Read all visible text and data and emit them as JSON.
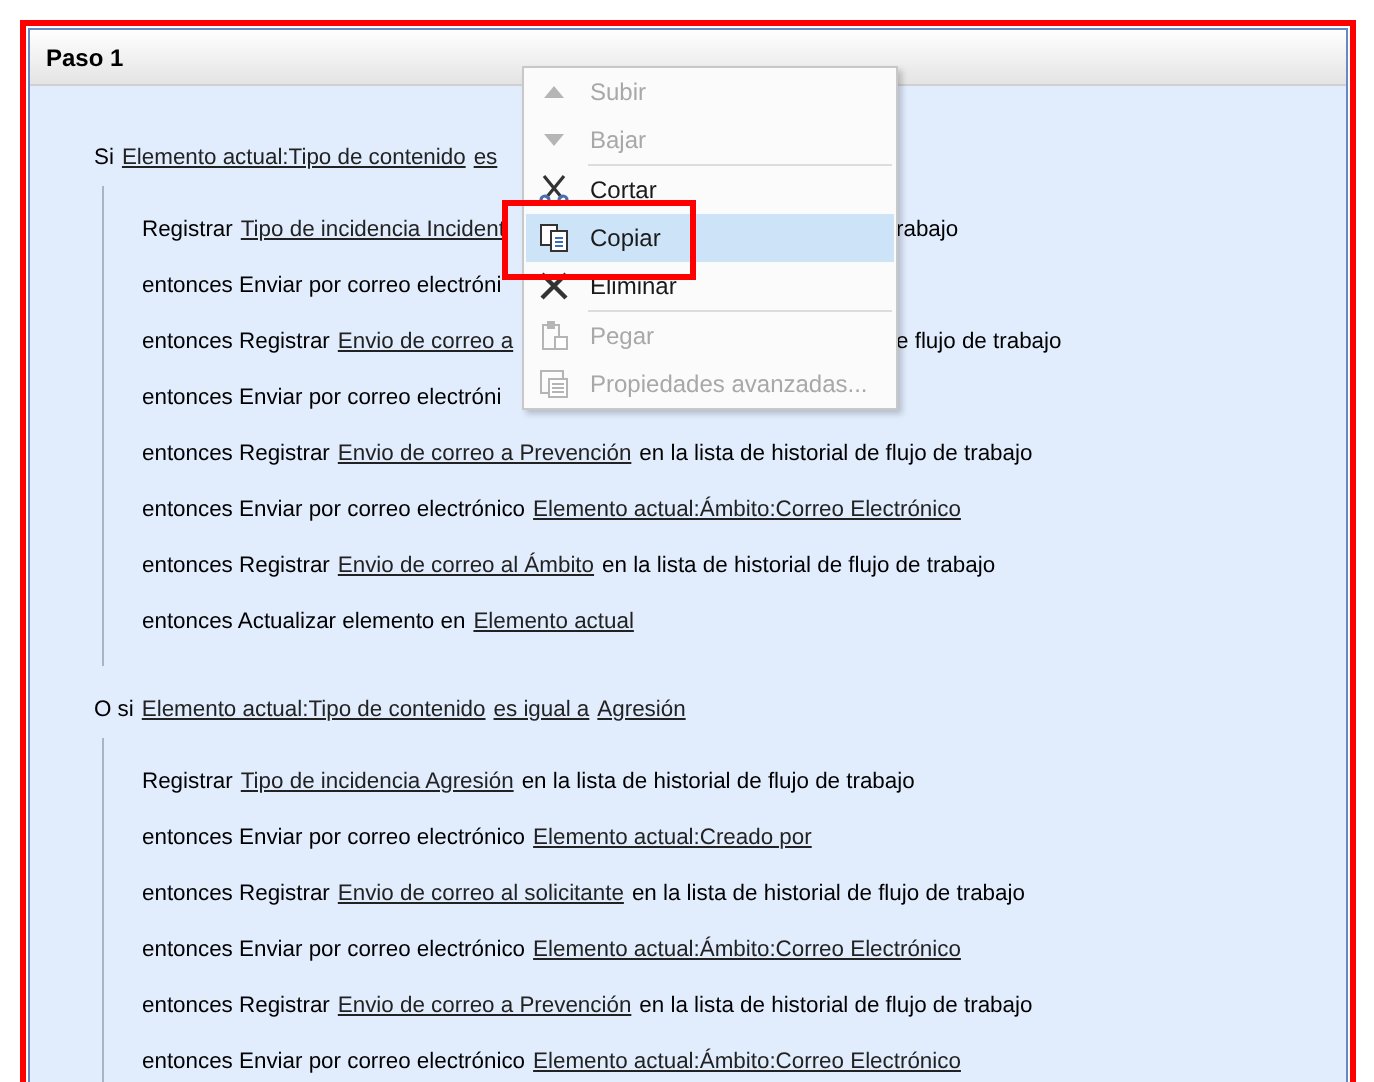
{
  "panel": {
    "title": "Paso 1"
  },
  "groups": [
    {
      "condition": {
        "parts": [
          {
            "text": "Si",
            "link": false
          },
          {
            "text": "Elemento actual:Tipo de contenido",
            "link": true
          },
          {
            "text": "es",
            "link": true
          }
        ]
      },
      "actions": [
        {
          "parts": [
            {
              "text": "Registrar",
              "link": false
            },
            {
              "text": "Tipo de incidencia Incident",
              "link": true
            }
          ],
          "after": [
            {
              "text": "rabajo",
              "link": false
            }
          ]
        },
        {
          "parts": [
            {
              "text": "entonces Enviar por correo electróni",
              "link": false
            }
          ]
        },
        {
          "parts": [
            {
              "text": "entonces Registrar",
              "link": false
            },
            {
              "text": "Envio de correo a",
              "link": true
            }
          ],
          "after": [
            {
              "text": "e flujo de trabajo",
              "link": false
            }
          ]
        },
        {
          "parts": [
            {
              "text": "entonces Enviar por correo electróni",
              "link": false
            }
          ]
        },
        {
          "parts": [
            {
              "text": "entonces Registrar",
              "link": false
            },
            {
              "text": "Envio de correo a Prevención",
              "link": true
            },
            {
              "text": "en la lista de historial de flujo de trabajo",
              "link": false
            }
          ]
        },
        {
          "parts": [
            {
              "text": "entonces Enviar por correo electrónico",
              "link": false
            },
            {
              "text": "Elemento actual:Ámbito:Correo Electrónico",
              "link": true
            }
          ]
        },
        {
          "parts": [
            {
              "text": "entonces Registrar",
              "link": false
            },
            {
              "text": "Envio de correo al Ámbito",
              "link": true
            },
            {
              "text": "en la lista de historial de flujo de trabajo",
              "link": false
            }
          ]
        },
        {
          "parts": [
            {
              "text": "entonces Actualizar elemento en",
              "link": false
            },
            {
              "text": "Elemento actual",
              "link": true
            }
          ]
        }
      ]
    },
    {
      "condition": {
        "parts": [
          {
            "text": "O si",
            "link": false
          },
          {
            "text": "Elemento actual:Tipo de contenido",
            "link": true
          },
          {
            "text": "es igual a",
            "link": true
          },
          {
            "text": "Agresión",
            "link": true
          }
        ]
      },
      "actions": [
        {
          "parts": [
            {
              "text": "Registrar",
              "link": false
            },
            {
              "text": "Tipo de incidencia Agresión",
              "link": true
            },
            {
              "text": "en la lista de historial de flujo de trabajo",
              "link": false
            }
          ]
        },
        {
          "parts": [
            {
              "text": "entonces Enviar por correo electrónico",
              "link": false
            },
            {
              "text": "Elemento actual:Creado por",
              "link": true
            }
          ]
        },
        {
          "parts": [
            {
              "text": "entonces Registrar",
              "link": false
            },
            {
              "text": "Envio de correo al solicitante",
              "link": true
            },
            {
              "text": "en la lista de historial de flujo de trabajo",
              "link": false
            }
          ]
        },
        {
          "parts": [
            {
              "text": "entonces Enviar por correo electrónico",
              "link": false
            },
            {
              "text": "Elemento actual:Ámbito:Correo Electrónico",
              "link": true
            }
          ]
        },
        {
          "parts": [
            {
              "text": "entonces Registrar",
              "link": false
            },
            {
              "text": "Envio de correo a Prevención",
              "link": true
            },
            {
              "text": "en la lista de historial de flujo de trabajo",
              "link": false
            }
          ]
        },
        {
          "parts": [
            {
              "text": "entonces Enviar por correo electrónico",
              "link": false
            },
            {
              "text": "Elemento actual:Ámbito:Correo Electrónico",
              "link": true
            }
          ]
        }
      ]
    }
  ],
  "context_menu": {
    "items": [
      {
        "kind": "up",
        "label": "Subir",
        "disabled": true,
        "selected": false
      },
      {
        "kind": "down",
        "label": "Bajar",
        "disabled": true,
        "selected": false
      },
      {
        "kind": "separator"
      },
      {
        "kind": "cut",
        "label": "Cortar",
        "disabled": false,
        "selected": false
      },
      {
        "kind": "copy",
        "label": "Copiar",
        "disabled": false,
        "selected": true
      },
      {
        "kind": "delete",
        "label": "Eliminar",
        "disabled": false,
        "selected": false
      },
      {
        "kind": "separator"
      },
      {
        "kind": "paste",
        "label": "Pegar",
        "disabled": true,
        "selected": false
      },
      {
        "kind": "properties",
        "label": "Propiedades avanzadas...",
        "disabled": true,
        "selected": false
      }
    ]
  }
}
